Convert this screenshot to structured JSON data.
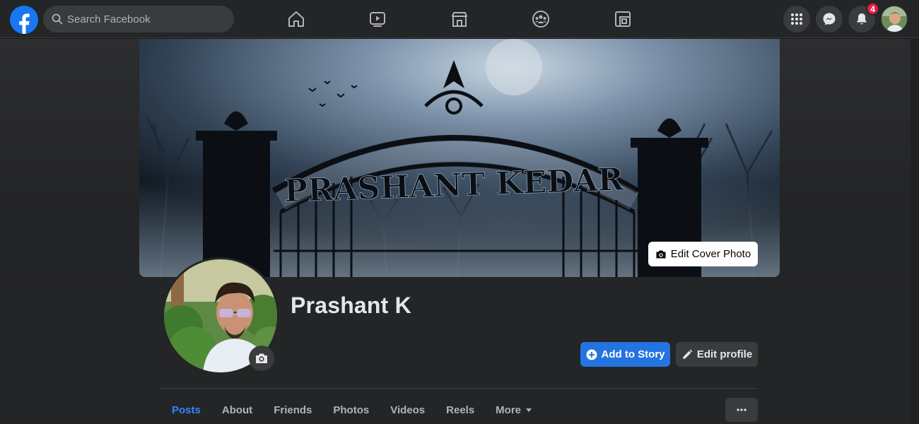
{
  "topbar": {
    "search_placeholder": "Search Facebook",
    "notification_count": "4",
    "nav_icons": [
      "home-icon",
      "watch-icon",
      "marketplace-icon",
      "groups-icon",
      "gaming-icon"
    ],
    "right_icons": [
      "menu-grid-icon",
      "messenger-icon",
      "bell-icon"
    ]
  },
  "cover": {
    "edit_cover_label": "Edit Cover Photo",
    "arch_text": "PRASHANT KEDAR"
  },
  "profile": {
    "name": "Prashant K",
    "add_story_label": "Add to Story",
    "edit_profile_label": "Edit profile"
  },
  "tabs": [
    {
      "label": "Posts",
      "active": true
    },
    {
      "label": "About",
      "active": false
    },
    {
      "label": "Friends",
      "active": false
    },
    {
      "label": "Photos",
      "active": false
    },
    {
      "label": "Videos",
      "active": false
    },
    {
      "label": "Reels",
      "active": false
    },
    {
      "label": "More",
      "active": false
    }
  ],
  "colors": {
    "brand_blue": "#1877f2",
    "primary_button": "#2374e1",
    "active_tab": "#2d88ff",
    "badge_red": "#e41e3f",
    "surface": "#242526",
    "background": "#18191a"
  }
}
